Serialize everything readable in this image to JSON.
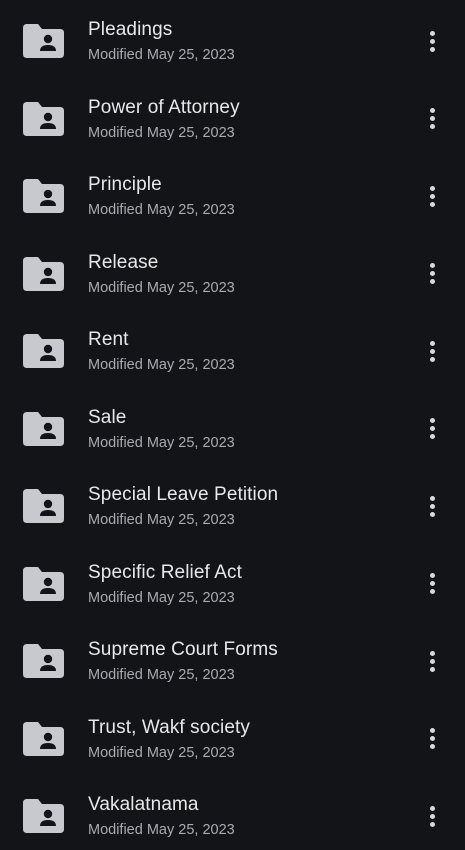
{
  "files": [
    {
      "name": "Pleadings",
      "modified": "Modified May 25, 2023"
    },
    {
      "name": "Power of Attorney",
      "modified": "Modified May 25, 2023"
    },
    {
      "name": "Principle",
      "modified": "Modified May 25, 2023"
    },
    {
      "name": "Release",
      "modified": "Modified May 25, 2023"
    },
    {
      "name": "Rent",
      "modified": "Modified May 25, 2023"
    },
    {
      "name": "Sale",
      "modified": "Modified May 25, 2023"
    },
    {
      "name": "Special Leave Petition",
      "modified": "Modified May 25, 2023"
    },
    {
      "name": "Specific Relief Act",
      "modified": "Modified May 25, 2023"
    },
    {
      "name": "Supreme Court Forms",
      "modified": "Modified May 25, 2023"
    },
    {
      "name": "Trust, Wakf society",
      "modified": "Modified May 25, 2023"
    },
    {
      "name": "Vakalatnama",
      "modified": "Modified May 25, 2023"
    }
  ],
  "icons": {
    "folder": "shared-folder-icon",
    "more": "more-vert-icon"
  },
  "colors": {
    "background": "#131417",
    "folder": "#c8c9ce",
    "primary_text": "#e8e8ea",
    "secondary_text": "#a9abb0"
  }
}
